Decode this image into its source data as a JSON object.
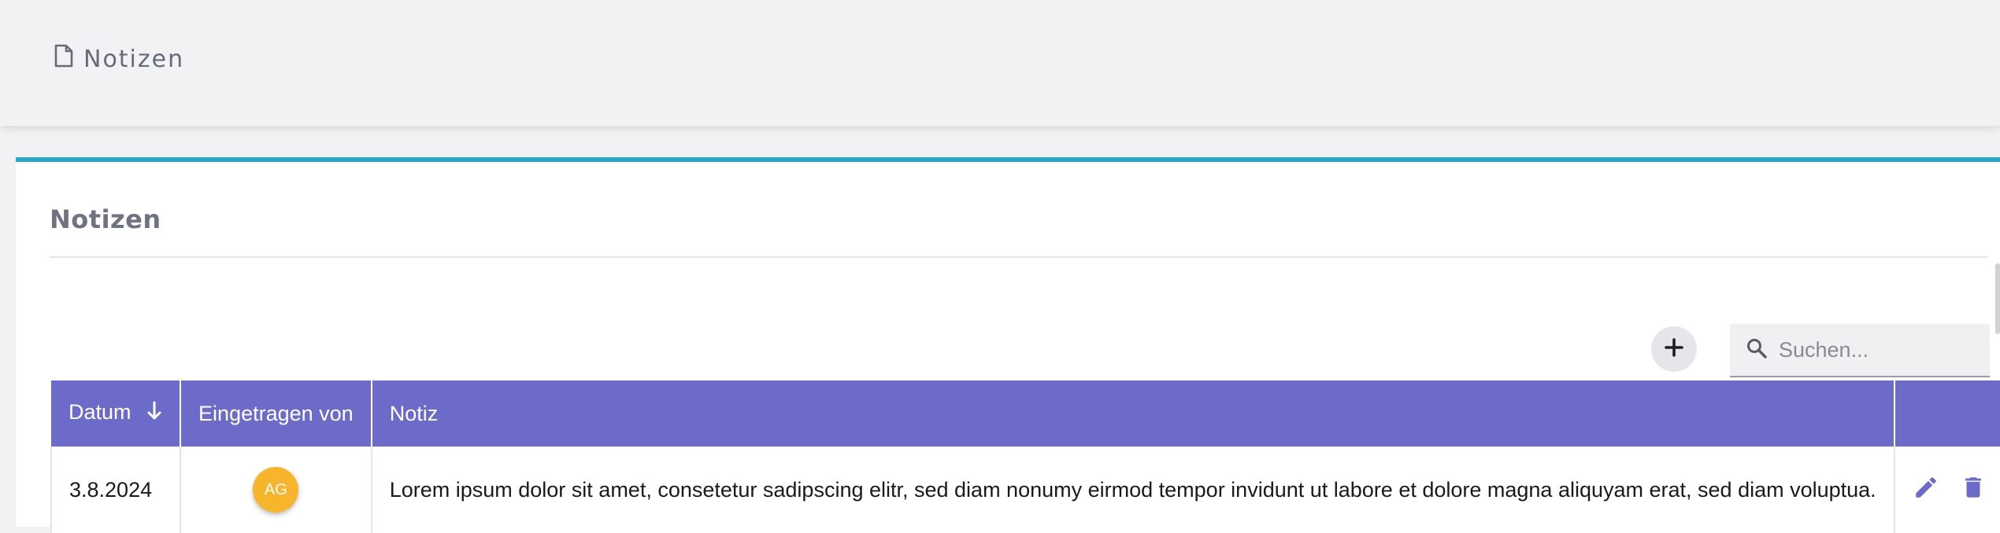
{
  "topbar": {
    "title": "Notizen",
    "icon": "document-icon"
  },
  "card": {
    "title": "Notizen"
  },
  "toolbar": {
    "add_icon": "plus-icon",
    "search_icon": "search-icon",
    "search_placeholder": "Suchen..."
  },
  "table": {
    "columns": [
      {
        "label": "Datum",
        "sort": "descending"
      },
      {
        "label": "Eingetragen von"
      },
      {
        "label": "Notiz"
      },
      {
        "label": ""
      }
    ],
    "rows": [
      {
        "datum": "3.8.2024",
        "initials": "AG",
        "notiz": "Lorem ipsum dolor sit amet, consetetur sadipscing elitr, sed diam nonumy eirmod tempor invidunt ut labore et dolore magna aliquyam erat, sed diam voluptua."
      }
    ]
  },
  "colors": {
    "accent_line": "#26a8c6",
    "header_bg": "#6c6bca",
    "avatar_bg": "#f7b52b",
    "action_icon": "#6c6bca"
  }
}
